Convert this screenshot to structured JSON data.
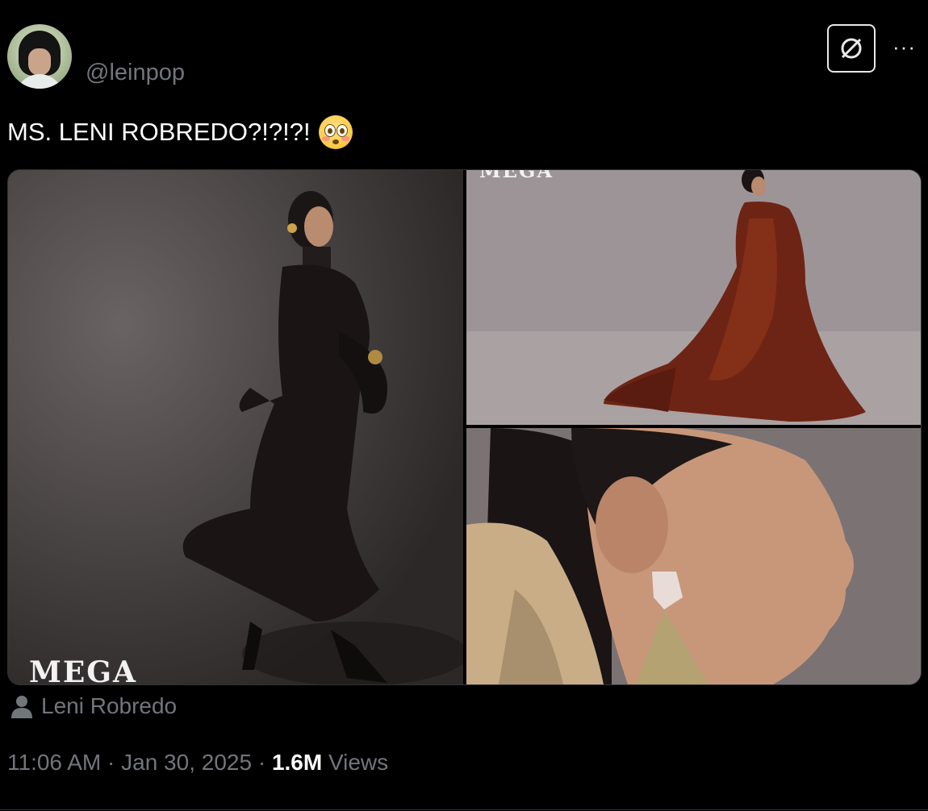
{
  "tweet": {
    "handle": "@leinpop",
    "text": "MS. LENI ROBREDO?!?!?!",
    "emoji": "flushed-face-emoji"
  },
  "media": {
    "photo_1_watermark": "MEGA",
    "photo_2_watermark": "MEGA"
  },
  "tag": {
    "name": "Leni Robredo",
    "icon": "person-icon"
  },
  "meta": {
    "time": "11:06 AM",
    "date": "Jan 30, 2025",
    "separator": "·",
    "views_count": "1.6M",
    "views_label": "Views"
  },
  "colors": {
    "background": "#000000",
    "text_primary": "#e7e9ea",
    "text_secondary": "#71767b",
    "border": "#2f3336"
  }
}
